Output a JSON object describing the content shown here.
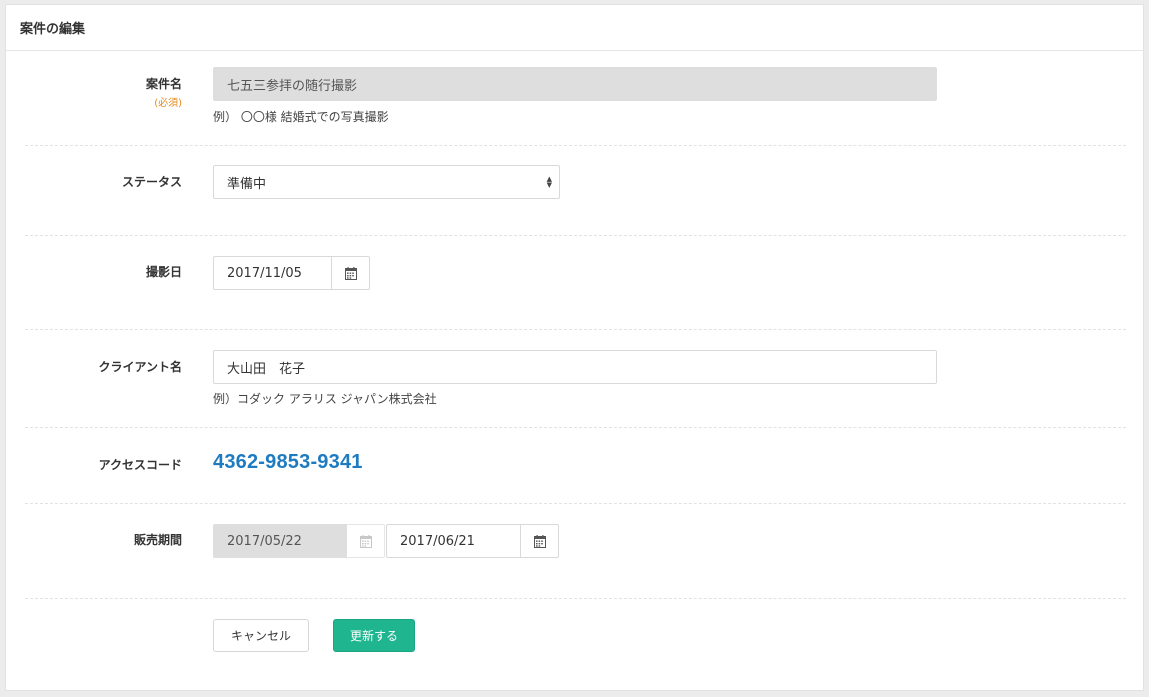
{
  "panel": {
    "title": "案件の編集"
  },
  "fields": {
    "case_name": {
      "label": "案件名",
      "required": "(必須)",
      "value": "七五三参拝の随行撮影",
      "help": "例） 〇〇様 結婚式での写真撮影"
    },
    "status": {
      "label": "ステータス",
      "selected": "準備中"
    },
    "shoot_date": {
      "label": "撮影日",
      "value": "2017/11/05",
      "icon": "calendar-icon"
    },
    "client_name": {
      "label": "クライアント名",
      "value": "大山田　花子",
      "help": "例）コダック アラリス ジャパン株式会社"
    },
    "access_code": {
      "label": "アクセスコード",
      "value": "4362-9853-9341"
    },
    "sales_period": {
      "label": "販売期間",
      "start": "2017/05/22",
      "end": "2017/06/21",
      "icon": "calendar-icon"
    }
  },
  "actions": {
    "cancel_label": "キャンセル",
    "update_label": "更新する"
  },
  "colors": {
    "accent": "#1eb58f",
    "link": "#1e7bc1",
    "required": "#e8891b"
  }
}
